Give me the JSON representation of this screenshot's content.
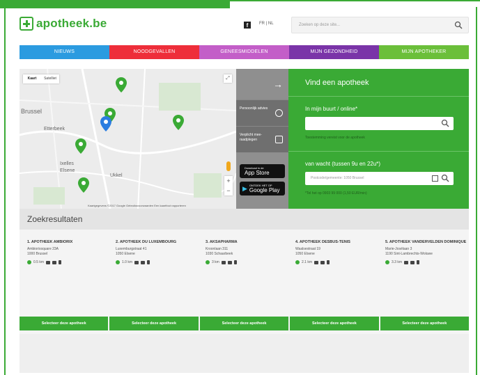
{
  "logo": {
    "text": "apotheek.be"
  },
  "header": {
    "facebook": "f",
    "languages": "FR | NL",
    "search_placeholder": "Zoeken op deze site..."
  },
  "nav": [
    {
      "label": "NIEUWS",
      "color": "#2b9be0"
    },
    {
      "label": "NOODGEVALLEN",
      "color": "#ee2e3a"
    },
    {
      "label": "GENEESMIDDELEN",
      "color": "#c35ec8"
    },
    {
      "label": "MIJN GEZONDHEID",
      "color": "#7a34a8"
    },
    {
      "label": "MIJN APOTHEKER",
      "color": "#6bbf3a"
    }
  ],
  "map": {
    "type_options": [
      "Kaart",
      "Satelliet"
    ],
    "cities": [
      "Brussel",
      "Etterbeek",
      "Ixelles",
      "Elsene",
      "Ukkel"
    ],
    "pins": [
      "1",
      "2",
      "3",
      "4",
      "5"
    ],
    "attribution": "Kaartgegevens ©2017 Google   Gebruiksvoorwaarden   Een kaartfout rapporteren"
  },
  "side": {
    "item1": "Persoonlijk advies",
    "item2": "Verplicht mee-raadplegen",
    "appstore_small": "Download in de",
    "appstore_big": "App Store",
    "googleplay_small": "ONTDEK HET OP",
    "googleplay_big": "Google Play"
  },
  "finder": {
    "title": "Vind een apotheek",
    "near_label": "In mijn buurt / online*",
    "near_note": "Toestemming vereist voor de apotheek",
    "duty_label": "van wacht (tussen 9u en 22u*)",
    "duty_placeholder": "Postcode/gemeente: 1050 Brussel",
    "duty_note": "*Tel het op 0903 99 000 (1,50 EUR/min)"
  },
  "results": {
    "title": "Zoekresultaten",
    "cards": [
      {
        "name": "1. APOTHEEK AMBIORIX",
        "addr1": "Ambiorixsquare 23A",
        "addr2": "1000 Brussel",
        "dist": "0.5 km"
      },
      {
        "name": "2. APOTHEEK DU LUXEMBOURG",
        "addr1": "Luxemburgstraat 41",
        "addr2": "1050 Elsene",
        "dist": "1.0 km"
      },
      {
        "name": "3. AKSAPHARMA",
        "addr1": "Kroonlaan 311",
        "addr2": "1030 Schaarbeek",
        "dist": "3 km"
      },
      {
        "name": "4. APOTHEEK DESBUS-TENIS",
        "addr1": "Waalsestraat 19",
        "addr2": "1050 Elsene",
        "dist": "2.1 km"
      },
      {
        "name": "5. APOTHEEK VANDERVELDEN DOMINIQUE",
        "addr1": "Marie-Josélaan 3",
        "addr2": "1190 Sint-Lambrechts-Woluwe",
        "dist": "3.3 km"
      }
    ],
    "button_label": "Selecteer deze apotheek"
  },
  "colors": {
    "brand": "#3aaa35",
    "grey": "#8f8f8f",
    "dark_grey": "#6f6f6f"
  }
}
